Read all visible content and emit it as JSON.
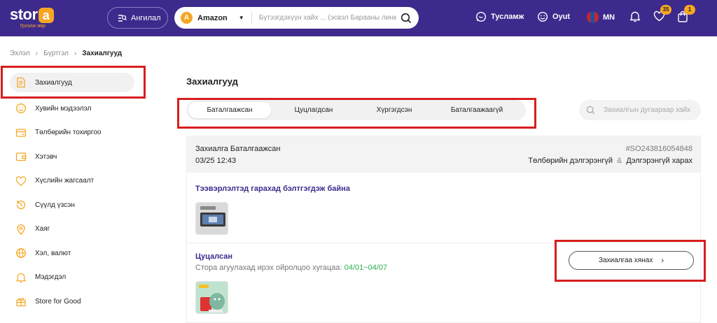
{
  "header": {
    "logo_text": "stor",
    "logo_letter": "a",
    "logo_tagline": "Үргэлж өөр",
    "category_label": "Ангилал",
    "store_badge": "A",
    "store_name": "Amazon",
    "search_placeholder": "Бүтээгдэхүүн хайх ... (эсвэл Барааны линк)",
    "help_label": "Тусламж",
    "oyut_label": "Oyut",
    "lang_label": "MN",
    "wishlist_count": "35",
    "cart_count": "1",
    "colors": {
      "brand": "#3d2a8c",
      "accent": "#f6a623"
    }
  },
  "breadcrumb": [
    "Эхлэл",
    "Бүртгэл",
    "Захиалгууд"
  ],
  "sidebar": {
    "items": [
      {
        "label": "Захиалгууд",
        "icon": "orders-icon"
      },
      {
        "label": "Хувийн мэдээлэл",
        "icon": "user-icon"
      },
      {
        "label": "Төлбөрийн тохиргоо",
        "icon": "payment-icon"
      },
      {
        "label": "Хэтэвч",
        "icon": "wallet-icon"
      },
      {
        "label": "Хүслийн жагсаалт",
        "icon": "heart-icon"
      },
      {
        "label": "Сүүлд үзсэн",
        "icon": "history-icon"
      },
      {
        "label": "Хаяг",
        "icon": "location-icon"
      },
      {
        "label": "Хэл, валют",
        "icon": "globe-icon"
      },
      {
        "label": "Мэдэгдэл",
        "icon": "bell-icon"
      },
      {
        "label": "Store for Good",
        "icon": "gift-icon"
      }
    ]
  },
  "main": {
    "title": "Захиалгууд",
    "tabs": [
      "Баталгаажсан",
      "Цуцлагдсан",
      "Хүргэгдсэн",
      "Баталгаажаагүй"
    ],
    "order_search_placeholder": "Захиалгын дугаараар хайх",
    "order": {
      "status": "Захиалга Баталгаажсан",
      "date": "03/25 12:43",
      "number": "#SO243816054848",
      "payment_link": "Төлбөрийн дэлгэрэнгүй",
      "amp": "&",
      "details_link": "Дэлгэрэнгүй харах",
      "package1_title": "Тээвэрлэлтэд гарахад бэлтгэгдэж байна",
      "package2_title": "Цуцалсан",
      "package2_eta_label": "Стора агуулахад ирэх ойролцоо хугацаа:",
      "package2_eta_dates": "04/01~04/07",
      "track_button": "Захиалгаа хянах",
      "track_chevron": "›"
    }
  }
}
